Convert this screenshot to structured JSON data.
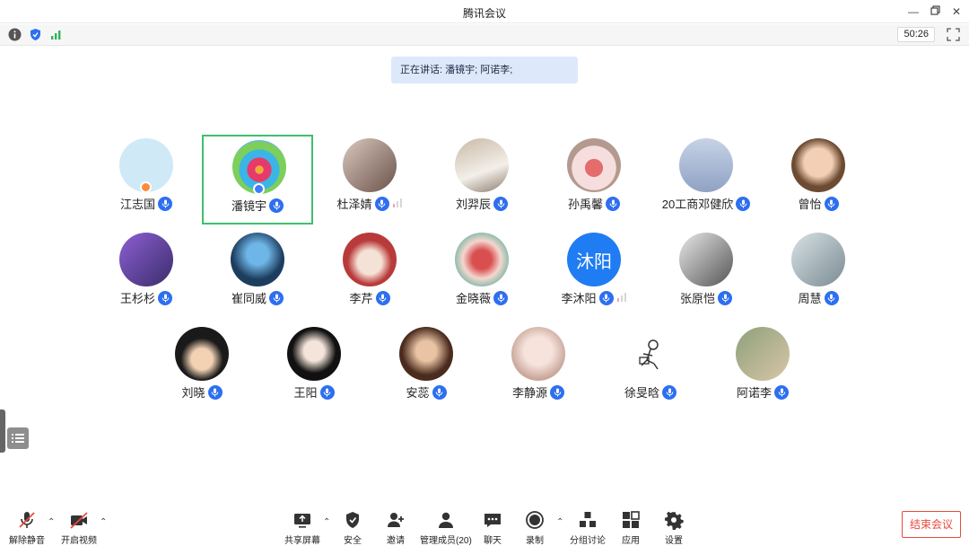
{
  "window": {
    "title": "腾讯会议"
  },
  "infobar": {
    "timer": "50:26"
  },
  "speaking": {
    "text": "正在讲话: 潘镜宇; 阿诺李;"
  },
  "participants": [
    {
      "name": "江志国"
    },
    {
      "name": "潘镜宇"
    },
    {
      "name": "杜泽婧"
    },
    {
      "name": "刘羿辰"
    },
    {
      "name": "孙禹馨"
    },
    {
      "name": "20工商邓健欣"
    },
    {
      "name": "曾怡"
    },
    {
      "name": "王杉杉"
    },
    {
      "name": "崔同威"
    },
    {
      "name": "李芹"
    },
    {
      "name": "金晓薇"
    },
    {
      "name": "李沐阳",
      "avatar_text": "沐阳"
    },
    {
      "name": "张原恺"
    },
    {
      "name": "周慧"
    },
    {
      "name": "刘晓"
    },
    {
      "name": "王阳"
    },
    {
      "name": "安蕊"
    },
    {
      "name": "李静源"
    },
    {
      "name": "徐旻晗"
    },
    {
      "name": "阿诺李"
    }
  ],
  "toolbar": {
    "unmute": "解除静音",
    "start_video": "开启视频",
    "share_screen": "共享屏幕",
    "security": "安全",
    "invite": "邀请",
    "manage_members": "管理成员(20)",
    "chat": "聊天",
    "record": "录制",
    "breakout": "分组讨论",
    "apps": "应用",
    "settings": "设置",
    "end_meeting": "结束会议"
  },
  "colors": {
    "accent": "#2d6ff0",
    "active_border": "#3fbf6f",
    "end_red": "#e84a3c"
  }
}
